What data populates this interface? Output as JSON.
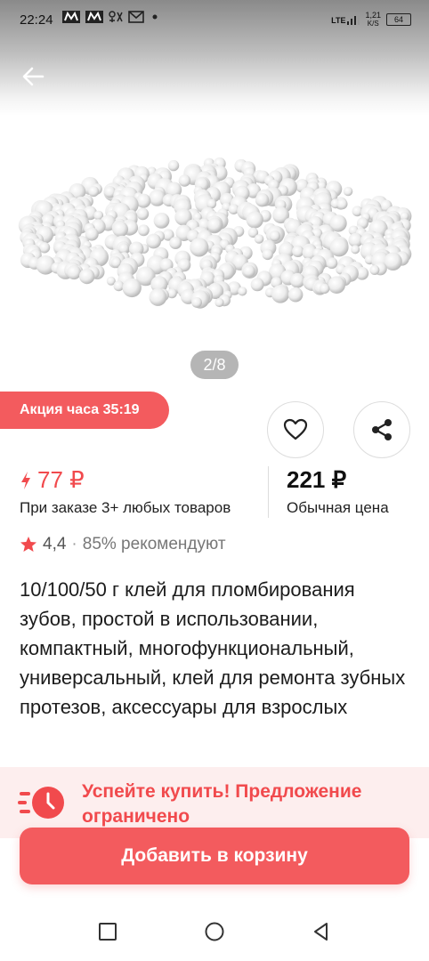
{
  "status_bar": {
    "time": "22:24",
    "left_icons": [
      "notification-m-icon",
      "notification-m-icon",
      "signal-tools-icon",
      "gmail-icon",
      "dot-icon"
    ],
    "network": "LTE",
    "speed_value": "1,21",
    "speed_unit": "K/S",
    "battery": "64"
  },
  "gallery": {
    "pager": "2/8"
  },
  "promo": {
    "badge": "Акция часа 35:19"
  },
  "price": {
    "sale": "77 ₽",
    "sale_note": "При заказе 3+ любых товаров",
    "regular": "221 ₽",
    "regular_note": "Обычная цена"
  },
  "rating": {
    "value": "4,4",
    "separator": "·",
    "recommend": "85% рекомендуют"
  },
  "product": {
    "title": "10/100/50 г клей для пломбирования зубов, простой в использовании, компактный, многофункциональный, универсальный, клей для ремонта зубных протезов, аксессуары для взрослых"
  },
  "offer": {
    "text": "Успейте купить! Предложение ограничено"
  },
  "cart": {
    "add_label": "Добавить в корзину"
  },
  "colors": {
    "accent": "#f35b5e",
    "price_red": "#f14a4d",
    "offer_bg": "#fdeeee"
  }
}
